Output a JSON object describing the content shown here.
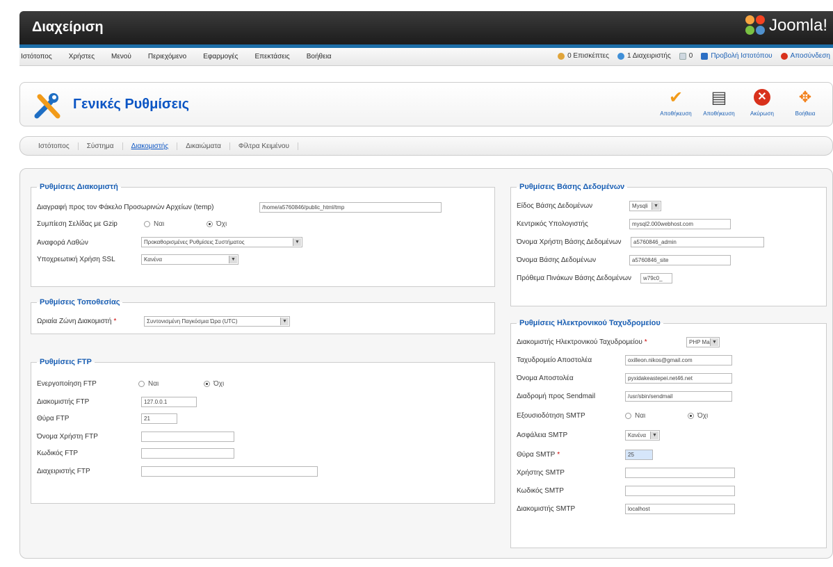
{
  "header": {
    "title": "Διαχείριση",
    "logo_text": "Joomla!"
  },
  "menu": [
    "Ιστότοπος",
    "Χρήστες",
    "Μενού",
    "Περιεχόμενο",
    "Εφαρμογές",
    "Επεκτάσεις",
    "Βοήθεια"
  ],
  "status": {
    "visitors": "0 Επισκέπτες",
    "admins": "1 Διαχειριστής",
    "messages": "0",
    "preview": "Προβολή Ιστοτόπου",
    "logout": "Αποσύνδεση"
  },
  "page": {
    "title": "Γενικές Ρυθμίσεις"
  },
  "toolbar": [
    {
      "label": "Αποθήκευση",
      "icon": "check-icon"
    },
    {
      "label": "Αποθήκευση",
      "icon": "save-icon"
    },
    {
      "label": "Ακύρωση",
      "icon": "cancel-icon"
    },
    {
      "label": "Βοήθεια",
      "icon": "help-icon"
    }
  ],
  "tabs": [
    "Ιστότοπος",
    "Σύστημα",
    "Διακομιστής",
    "Δικαιώματα",
    "Φίλτρα Κειμένου"
  ],
  "server": {
    "legend": "Ρυθμίσεις Διακομιστή",
    "tmp_label": "Διαγραφή προς τον Φάκελο Προσωρινών Αρχείων (temp)",
    "tmp_value": "/home/a5760846/public_html/tmp",
    "gzip_label": "Συμπίεση Σελίδας με Gzip",
    "yes": "Ναι",
    "no": "Όχι",
    "error_label": "Αναφορά Λαθών",
    "error_value": "Προκαθορισμένες Ρυθμίσεις Συστήματος",
    "ssl_label": "Υποχρεωτική Χρήση SSL",
    "ssl_value": "Κανένα"
  },
  "location": {
    "legend": "Ρυθμίσεις Τοποθεσίας",
    "tz_label": "Ωριαία Ζώνη Διακομιστή",
    "tz_value": "Συντονισμένη Παγκόσμια Ώρα (UTC)"
  },
  "ftp": {
    "legend": "Ρυθμίσεις FTP",
    "enable_label": "Ενεργοποίηση FTP",
    "yes": "Ναι",
    "no": "Όχι",
    "host_label": "Διακομιστής FTP",
    "host_value": "127.0.0.1",
    "port_label": "Θύρα FTP",
    "port_value": "21",
    "user_label": "Όνομα Χρήστη FTP",
    "pass_label": "Κωδικός FTP",
    "root_label": "Διαχειριστής FTP"
  },
  "database": {
    "legend": "Ρυθμίσεις Βάσης Δεδομένων",
    "type_label": "Είδος Βάσης Δεδομένων",
    "type_value": "Mysqli",
    "host_label": "Κεντρικός Υπολογιστής",
    "host_value": "mysql2.000webhost.com",
    "user_label": "Όνομα Χρήστη Βάσης Δεδομένων",
    "user_value": "a5760846_admin",
    "name_label": "Όνομα Βάσης Δεδομένων",
    "name_value": "a5760846_site",
    "prefix_label": "Πρόθεμα Πινάκων Βάσης Δεδομένων",
    "prefix_value": "w79c0_"
  },
  "mail": {
    "legend": "Ρυθμίσεις Ηλεκτρονικού Ταχυδρομείου",
    "mailer_label": "Διακομιστής Ηλεκτρονικού Ταχυδρομείου",
    "mailer_value": "PHP Mail",
    "from_label": "Ταχυδρομείο Αποστολέα",
    "from_value": "oxilleon.nikos@gmail.com",
    "fromname_label": "Όνομα Αποστολέα",
    "fromname_value": "pyxidakeastepei.net46.net",
    "sendmail_label": "Διαδρομή προς Sendmail",
    "sendmail_value": "/usr/sbin/sendmail",
    "smtpauth_label": "Εξουσιοδότηση SMTP",
    "yes": "Ναι",
    "no": "Όχι",
    "smtpsecure_label": "Ασφάλεια SMTP",
    "smtpsecure_value": "Κανένα",
    "smtpport_label": "Θύρα SMTP",
    "smtpport_value": "25",
    "smtpuser_label": "Χρήστης SMTP",
    "smtppass_label": "Κωδικός SMTP",
    "smtphost_label": "Διακομιστής SMTP",
    "smtphost_value": "localhost"
  }
}
